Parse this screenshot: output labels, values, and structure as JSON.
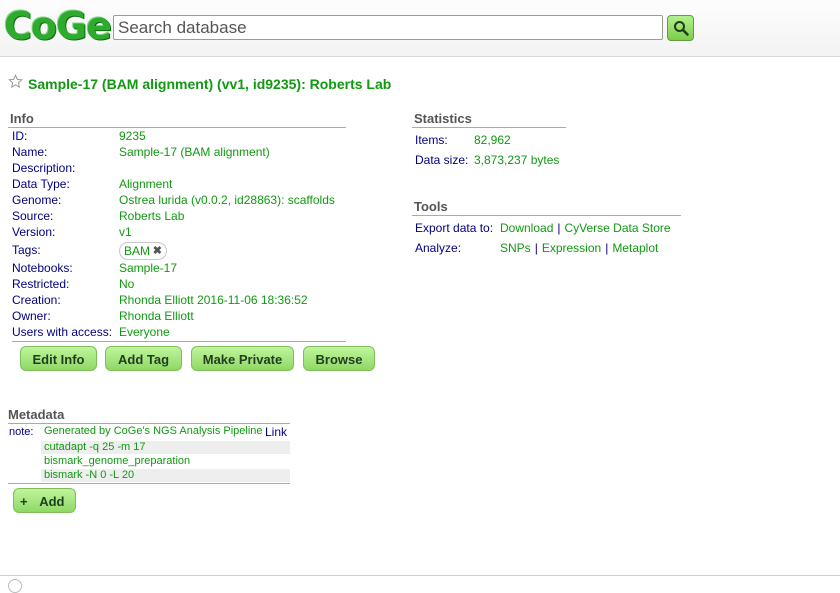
{
  "header": {
    "logo": "CoGe",
    "search_placeholder": "Search database"
  },
  "title": "Sample-17 (BAM alignment) (vv1, id9235): Roberts Lab",
  "info": {
    "heading": "Info",
    "rows": [
      {
        "key": "ID:",
        "value": "9235"
      },
      {
        "key": "Name:",
        "value": "Sample-17 (BAM alignment)"
      },
      {
        "key": "Description:",
        "value": ""
      },
      {
        "key": "Data Type:",
        "value": "Alignment"
      },
      {
        "key": "Genome:",
        "value": "Ostrea lurida (v0.0.2, id28863): scaffolds"
      },
      {
        "key": "Source:",
        "value": "Roberts Lab"
      },
      {
        "key": "Version:",
        "value": "v1"
      },
      {
        "key": "Tags:",
        "value": "BAM"
      },
      {
        "key": "Notebooks:",
        "value": "Sample-17"
      },
      {
        "key": "Restricted:",
        "value": "No"
      },
      {
        "key": "Creation:",
        "value": "Rhonda Elliott 2016-11-06 18:36:52"
      },
      {
        "key": "Owner:",
        "value": "Rhonda Elliott"
      },
      {
        "key": "Users with access:",
        "value": "Everyone"
      }
    ],
    "buttons": {
      "edit_info": "Edit Info",
      "add_tag": "Add Tag",
      "make_private": "Make Private",
      "browse": "Browse"
    }
  },
  "statistics": {
    "heading": "Statistics",
    "items_label": "Items:",
    "items_value": "82,962",
    "size_label": "Data size:",
    "size_value": "3,873,237 bytes"
  },
  "tools": {
    "heading": "Tools",
    "export_label": "Export data to:",
    "export_links": [
      "Download",
      "CyVerse Data Store"
    ],
    "analyze_label": "Analyze:",
    "analyze_links": [
      "SNPs",
      "Expression",
      "Metaplot"
    ],
    "separator": "|"
  },
  "metadata": {
    "heading": "Metadata",
    "key": "note:",
    "lines": [
      "Generated by CoGe's NGS Analysis Pipeline",
      "cutadapt -q 25 -m 17",
      "bismark_genome_preparation",
      "bismark -N 0 -L 20"
    ],
    "link_label": "Link",
    "add_label": "Add",
    "add_icon": "+"
  }
}
